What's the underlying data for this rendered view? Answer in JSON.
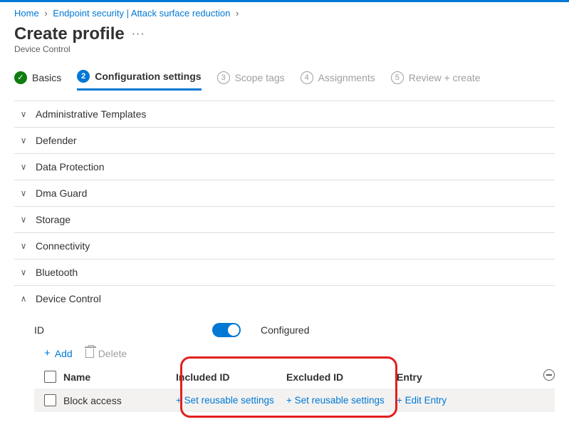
{
  "breadcrumb": {
    "home": "Home",
    "item1": "Endpoint security | Attack surface reduction"
  },
  "page": {
    "title": "Create profile",
    "subtitle": "Device Control",
    "more": "···"
  },
  "tabs": {
    "basics": {
      "label": "Basics"
    },
    "config": {
      "num": "2",
      "label": "Configuration settings"
    },
    "scope": {
      "num": "3",
      "label": "Scope tags"
    },
    "assign": {
      "num": "4",
      "label": "Assignments"
    },
    "review": {
      "num": "5",
      "label": "Review + create"
    }
  },
  "sections": {
    "s1": "Administrative Templates",
    "s2": "Defender",
    "s3": "Data Protection",
    "s4": "Dma Guard",
    "s5": "Storage",
    "s6": "Connectivity",
    "s7": "Bluetooth",
    "s8": "Device Control"
  },
  "device_control": {
    "id_label": "ID",
    "toggle_label": "Configured",
    "add": "Add",
    "delete": "Delete",
    "columns": {
      "name": "Name",
      "included": "Included ID",
      "excluded": "Excluded ID",
      "entry": "Entry"
    },
    "row": {
      "name": "Block access",
      "included_action": "+ Set reusable settings",
      "excluded_action": "+ Set reusable settings",
      "entry_action": "+ Edit Entry"
    }
  }
}
